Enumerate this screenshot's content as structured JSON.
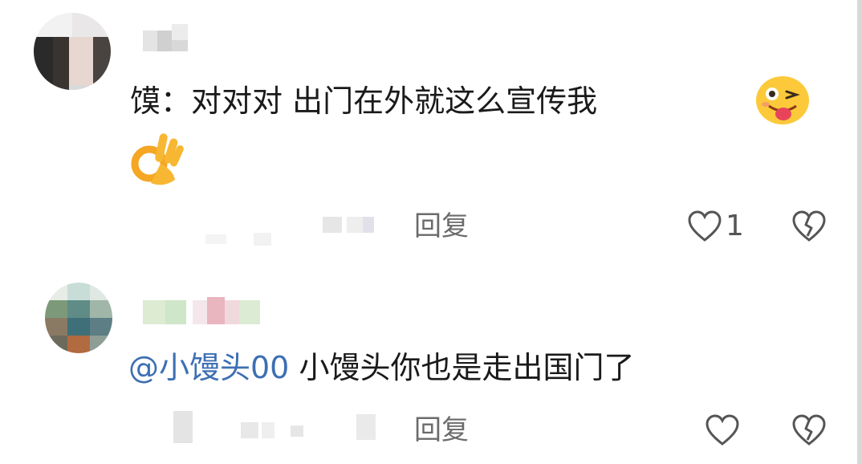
{
  "comments": [
    {
      "text_prefix": "馍：",
      "text_body": "对对对 出门在外就这么宣传我",
      "emojis": [
        "wink-tongue-emoji",
        "ok-hand-emoji"
      ],
      "reply_label": "回复",
      "like_count": "1"
    },
    {
      "mention": "@小馒头00",
      "text_body": "小馒头你也是走出国门了",
      "reply_label": "回复",
      "like_count": ""
    }
  ],
  "colors": {
    "mention": "#3d6fb3",
    "meta_text": "#6b6b6b",
    "icon_stroke": "#555555"
  }
}
